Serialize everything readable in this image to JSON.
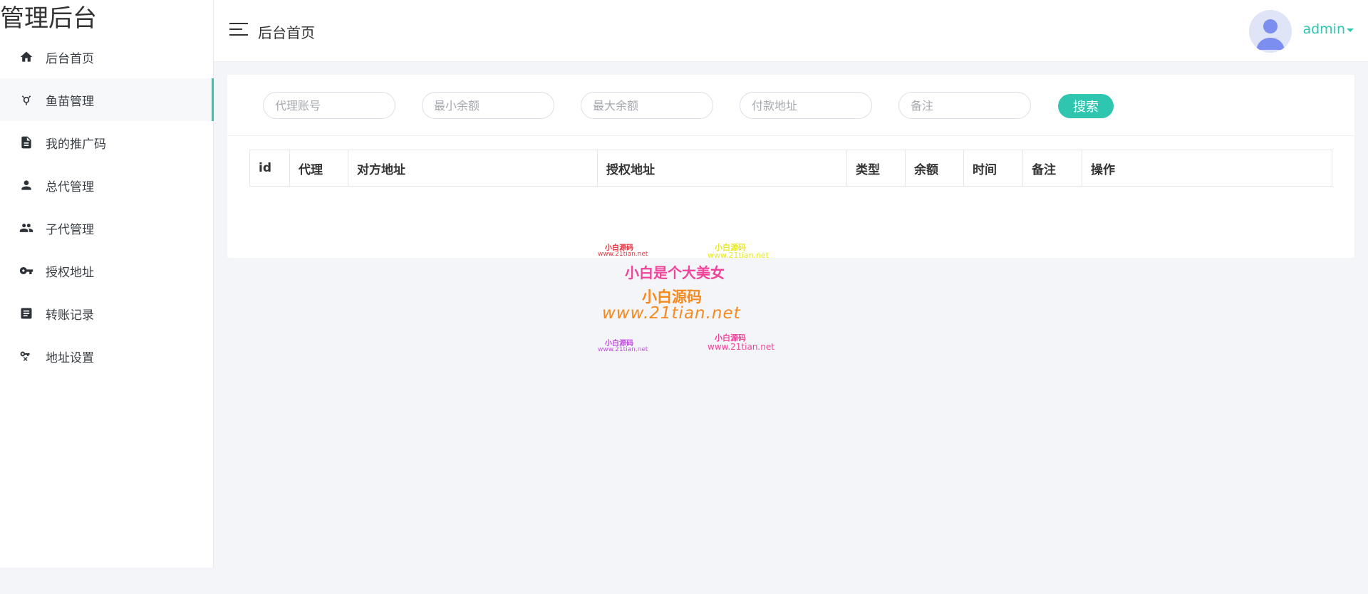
{
  "brand": {
    "title": "管理后台"
  },
  "sidebar": {
    "items": [
      {
        "label": "后台首页",
        "icon": "home-icon"
      },
      {
        "label": "鱼苗管理",
        "icon": "fish-icon",
        "active": true
      },
      {
        "label": "我的推广码",
        "icon": "document-icon"
      },
      {
        "label": "总代管理",
        "icon": "user-icon"
      },
      {
        "label": "子代管理",
        "icon": "users-icon"
      },
      {
        "label": "授权地址",
        "icon": "key-icon"
      },
      {
        "label": "转账记录",
        "icon": "record-icon"
      },
      {
        "label": "地址设置",
        "icon": "key-settings-icon"
      }
    ]
  },
  "header": {
    "title": "后台首页",
    "user": "admin"
  },
  "filters": {
    "agent_placeholder": "代理账号",
    "min_balance_placeholder": "最小余额",
    "max_balance_placeholder": "最大余额",
    "pay_address_placeholder": "付款地址",
    "remark_placeholder": "备注",
    "search_label": "搜索"
  },
  "table": {
    "columns": [
      "id",
      "代理",
      "对方地址",
      "授权地址",
      "类型",
      "余额",
      "时间",
      "备注",
      "操作"
    ]
  },
  "watermark": {
    "line1a": "小白源码",
    "line1a_url": "www.21tian.net",
    "line1b": "小白源码",
    "line1b_url": "www.21tian.net",
    "slogan": "小白是个大美女",
    "big_name": "小白源码",
    "big_url": "www.21tian.net",
    "line4a": "小白源码",
    "line4a_url": "www.21tian.net",
    "line4b": "小白源码",
    "line4b_url": "www.21tian.net"
  },
  "colors": {
    "accent": "#2fc6b0",
    "background": "#f4f5f9",
    "sidebar_bg": "#ffffff"
  }
}
